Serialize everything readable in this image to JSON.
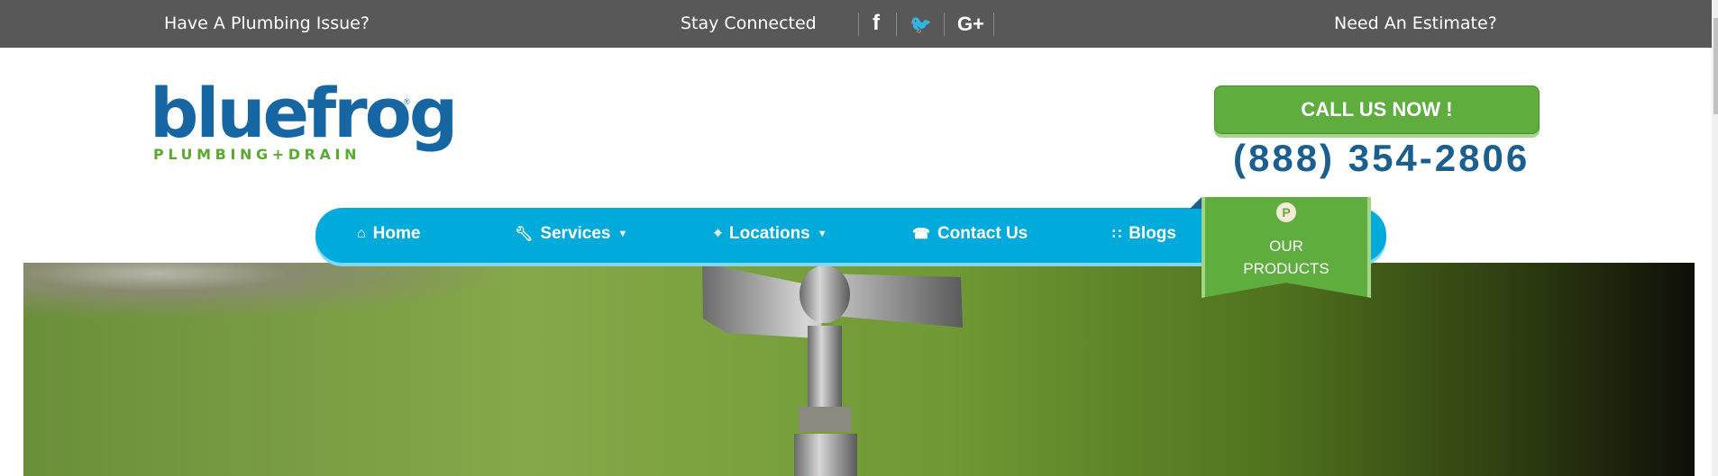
{
  "topbar": {
    "left": "Have A Plumbing Issue?",
    "center": "Stay Connected",
    "right": "Need An Estimate?",
    "social": [
      "f",
      "t",
      "G+"
    ]
  },
  "logo": {
    "word": "bluefrog",
    "sub": "PLUMBING+DRAIN"
  },
  "call": {
    "label": "CALL US NOW !",
    "phone": "(888) 354-2806"
  },
  "nav": [
    {
      "label": "Home"
    },
    {
      "label": "Services"
    },
    {
      "label": "Locations"
    },
    {
      "label": "Contact Us"
    },
    {
      "label": "Blogs"
    }
  ],
  "products": {
    "badge": "P",
    "line1": "OUR",
    "line2": "PRODUCTS"
  },
  "colors": {
    "brand_blue": "#1566a3",
    "green": "#5fad3f",
    "nav": "#00aadb"
  }
}
